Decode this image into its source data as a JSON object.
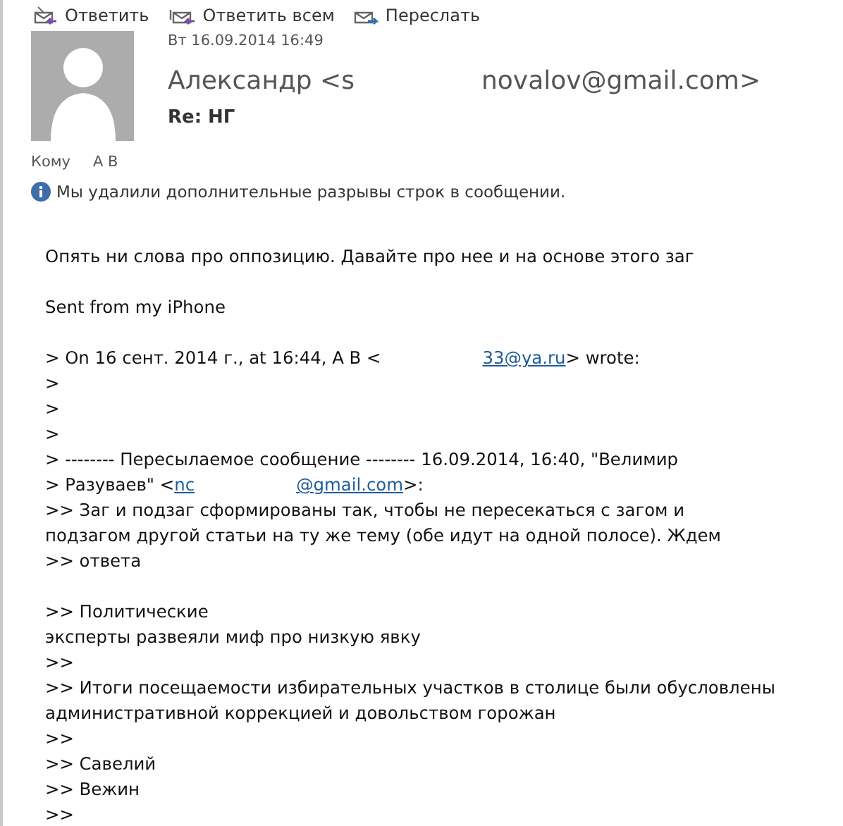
{
  "toolbar": [
    {
      "kind": "reply",
      "label": "Ответить"
    },
    {
      "kind": "reply-all",
      "label": "Ответить всем"
    },
    {
      "kind": "forward",
      "label": "Переслать"
    }
  ],
  "header": {
    "date": "Вт 16.09.2014 16:49",
    "sender_parts": [
      "Александр <s",
      "novalov@gmail.com>"
    ],
    "subject": "Re: НГ",
    "to_label": "Кому",
    "to": "А В",
    "info": "Мы удалили дополнительные разрывы строк в сообщении."
  },
  "body": [
    [
      {
        "kind": "text",
        "text": "Опять ни слова про оппозицию. Давайте про нее и на основе этого заг"
      }
    ],
    [
      {
        "kind": "blank"
      }
    ],
    [
      {
        "kind": "text",
        "text": "Sent from my iPhone"
      }
    ],
    [
      {
        "kind": "blank"
      }
    ],
    [
      {
        "kind": "text",
        "text": "> On 16 сент. 2014 г., at 16:44, А В <"
      },
      {
        "kind": "redacted"
      },
      {
        "kind": "link",
        "text": "33@ya.ru"
      },
      {
        "kind": "text",
        "text": "> wrote:"
      }
    ],
    [
      {
        "kind": "text",
        "text": ">"
      }
    ],
    [
      {
        "kind": "text",
        "text": ">"
      }
    ],
    [
      {
        "kind": "text",
        "text": ">"
      }
    ],
    [
      {
        "kind": "text",
        "text": "> -------- Пересылаемое сообщение  -------- 16.09.2014, 16:40, \"Велимир"
      }
    ],
    [
      {
        "kind": "text",
        "text": "> Разуваев\" <"
      },
      {
        "kind": "link",
        "text": "nc"
      },
      {
        "kind": "redacted"
      },
      {
        "kind": "link",
        "text": "@gmail.com"
      },
      {
        "kind": "text",
        "text": ">:"
      }
    ],
    [
      {
        "kind": "text",
        "text": ">> Заг и подзаг сформированы так, чтобы не пересекаться с загом и"
      }
    ],
    [
      {
        "kind": "text",
        "text": "подзагом другой статьи на ту же тему (обе идут на одной полосе). Ждем"
      }
    ],
    [
      {
        "kind": "text",
        "text": ">> ответа"
      }
    ],
    [
      {
        "kind": "blank"
      }
    ],
    [
      {
        "kind": "text",
        "text": ">> Политические"
      }
    ],
    [
      {
        "kind": "text",
        "text": "эксперты развеяли миф про низкую явку"
      }
    ],
    [
      {
        "kind": "text",
        "text": ">>"
      }
    ],
    [
      {
        "kind": "text",
        "text": ">> Итоги посещаемости избирательных участков в столице были обусловлены"
      }
    ],
    [
      {
        "kind": "text",
        "text": "административной коррекцией и довольством горожан"
      }
    ],
    [
      {
        "kind": "text",
        "text": ">>"
      }
    ],
    [
      {
        "kind": "text",
        "text": ">> Савелий"
      }
    ],
    [
      {
        "kind": "text",
        "text": ">> Вежин"
      }
    ],
    [
      {
        "kind": "text",
        "text": ">>"
      }
    ]
  ]
}
